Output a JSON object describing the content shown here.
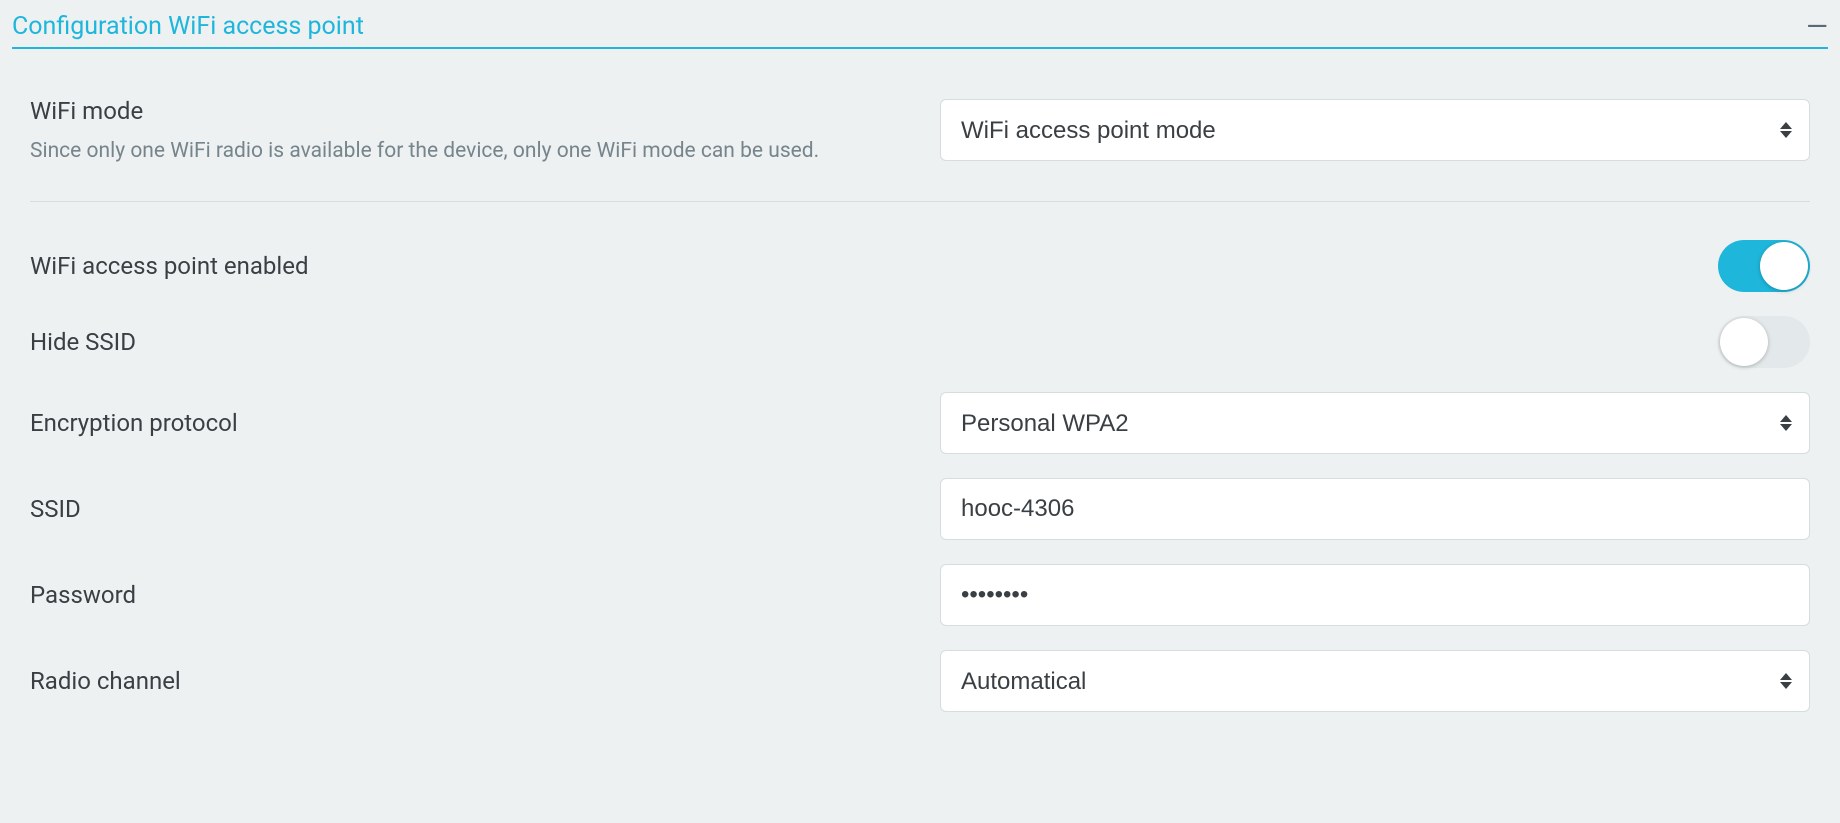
{
  "panel": {
    "title": "Configuration WiFi access point"
  },
  "fields": {
    "wifi_mode": {
      "label": "WiFi mode",
      "helper": "Since only one WiFi radio is available for the device, only one WiFi mode can be used.",
      "value": "WiFi access point mode"
    },
    "ap_enabled": {
      "label": "WiFi access point enabled",
      "value": true
    },
    "hide_ssid": {
      "label": "Hide SSID",
      "value": false
    },
    "encryption": {
      "label": "Encryption protocol",
      "value": "Personal WPA2"
    },
    "ssid": {
      "label": "SSID",
      "value": "hooc-4306"
    },
    "password": {
      "label": "Password",
      "value": "••••••••"
    },
    "radio_channel": {
      "label": "Radio channel",
      "value": "Automatical"
    }
  }
}
